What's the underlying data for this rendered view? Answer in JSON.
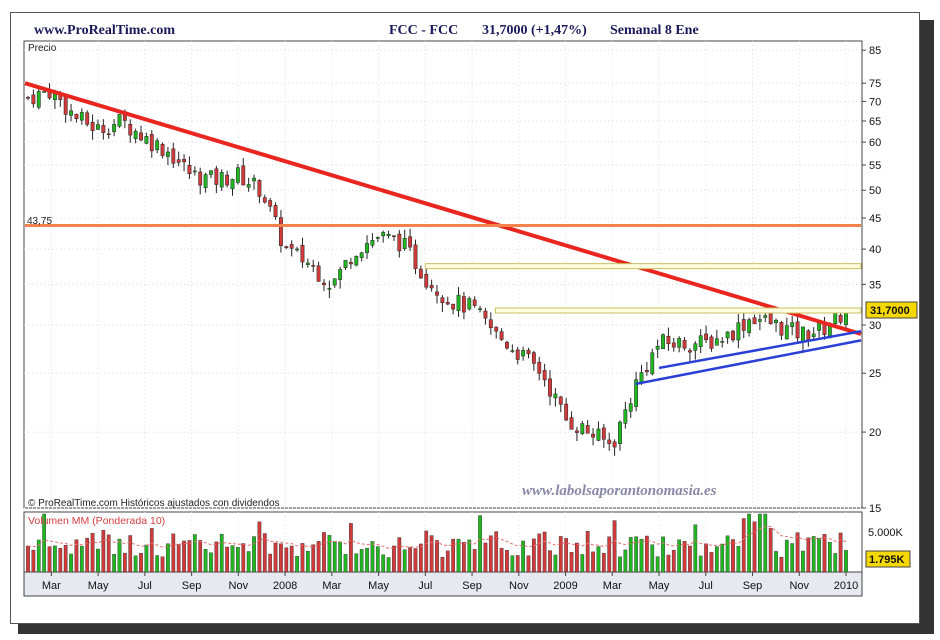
{
  "header": {
    "site": "www.ProRealTime.com",
    "instrument": "FCC - FCC",
    "price_change": "31,7000 (+1,47%)",
    "period": "Semanal  8 Ene"
  },
  "price_panel": {
    "ylabel": "Precio",
    "footer": "© ProRealTime.com  Históricos ajustados con dividendos",
    "watermark": "www.labolsaporantonomasia.es",
    "level_label": "43,75",
    "last_price_label": "31,7000"
  },
  "volume_panel": {
    "title": "Volumen MM (Ponderada 10)",
    "scale_label": "5.000K",
    "last_volume_label": "1.795K"
  },
  "colors": {
    "up": "#22b522",
    "down": "#d13a3a",
    "resistance_line": "#e8261f",
    "support_level": "#f5824d",
    "channel_line": "#2a3fd6",
    "horizontal_levels": "#c9c060",
    "moving_average": "#e87070"
  },
  "chart_data": [
    {
      "type": "candlestick",
      "scale": "log",
      "ylabel": "Precio",
      "ylim": [
        15,
        88
      ],
      "y_ticks": [
        15,
        20,
        25,
        30,
        35,
        40,
        45,
        50,
        55,
        60,
        65,
        70,
        75,
        85
      ],
      "x_ticks": [
        "Mar",
        "May",
        "Jul",
        "Sep",
        "Nov",
        "2008",
        "Mar",
        "May",
        "Jul",
        "Sep",
        "Nov",
        "2009",
        "Mar",
        "May",
        "Jul",
        "Sep",
        "Nov",
        "2010"
      ],
      "x_range": [
        "2007-02",
        "2010-01"
      ],
      "approx_close_path": [
        {
          "x": "2007-02",
          "y": 71
        },
        {
          "x": "2007-03",
          "y": 73
        },
        {
          "x": "2007-04",
          "y": 66
        },
        {
          "x": "2007-05",
          "y": 63
        },
        {
          "x": "2007-06",
          "y": 65
        },
        {
          "x": "2007-07",
          "y": 61
        },
        {
          "x": "2007-08",
          "y": 58
        },
        {
          "x": "2007-09",
          "y": 53
        },
        {
          "x": "2007-10",
          "y": 52
        },
        {
          "x": "2007-11",
          "y": 53
        },
        {
          "x": "2007-12",
          "y": 50
        },
        {
          "x": "2008-01",
          "y": 40
        },
        {
          "x": "2008-02",
          "y": 38
        },
        {
          "x": "2008-03",
          "y": 35
        },
        {
          "x": "2008-04",
          "y": 40
        },
        {
          "x": "2008-05",
          "y": 42
        },
        {
          "x": "2008-06",
          "y": 41
        },
        {
          "x": "2008-07",
          "y": 36
        },
        {
          "x": "2008-08",
          "y": 33
        },
        {
          "x": "2008-09",
          "y": 32
        },
        {
          "x": "2008-10",
          "y": 29
        },
        {
          "x": "2008-11",
          "y": 27
        },
        {
          "x": "2008-12",
          "y": 25
        },
        {
          "x": "2009-01",
          "y": 21
        },
        {
          "x": "2009-02",
          "y": 20
        },
        {
          "x": "2009-03",
          "y": 19
        },
        {
          "x": "2009-04",
          "y": 24
        },
        {
          "x": "2009-05",
          "y": 28
        },
        {
          "x": "2009-06",
          "y": 28
        },
        {
          "x": "2009-07",
          "y": 28
        },
        {
          "x": "2009-08",
          "y": 29
        },
        {
          "x": "2009-09",
          "y": 31
        },
        {
          "x": "2009-10",
          "y": 30
        },
        {
          "x": "2009-11",
          "y": 29
        },
        {
          "x": "2009-12",
          "y": 29.5
        },
        {
          "x": "2010-01",
          "y": 31.7
        }
      ],
      "last_close": 31.7,
      "drawn_lines": [
        {
          "name": "downtrend",
          "from": {
            "x": "2007-02",
            "y": 75
          },
          "to": {
            "x": "2010-01",
            "y": 29.5
          }
        },
        {
          "name": "support",
          "y": 43.75
        },
        {
          "name": "level_1",
          "from_x": "2008-07",
          "y": 37.5
        },
        {
          "name": "level_2",
          "from_x": "2008-10",
          "y": 31.7
        },
        {
          "name": "channel_upper",
          "from": {
            "x": "2009-05",
            "y": 25.5
          },
          "to": {
            "x": "2010-01",
            "y": 29
          }
        },
        {
          "name": "channel_lower",
          "from": {
            "x": "2009-04",
            "y": 24
          },
          "to": {
            "x": "2010-01",
            "y": 28
          }
        }
      ]
    },
    {
      "type": "bar",
      "title": "Volumen MM (Ponderada 10)",
      "scale_label": "5.000K",
      "last_value_label": "1.795K",
      "last_value_k": 1795
    }
  ]
}
